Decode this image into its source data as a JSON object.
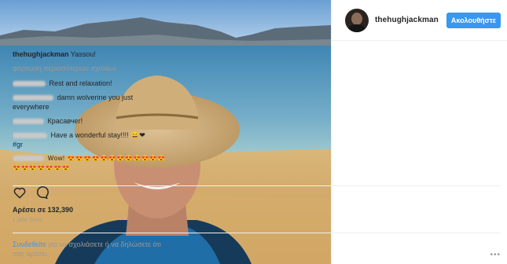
{
  "header": {
    "username": "thehughjackman",
    "follow_label": "Ακολουθήστε"
  },
  "caption": {
    "author": "thehughjackman",
    "text": "Yassou!"
  },
  "load_more": "φόρτωση περισσότερων σχολίων",
  "comments": [
    {
      "text": "Rest and relaxation!"
    },
    {
      "text": "damn wolverine you just everywhere"
    },
    {
      "text": "Красавчег!"
    },
    {
      "text": "Have a wonderful stay!!!! 😄❤",
      "tag": "#gr"
    },
    {
      "text": "Wow! 😍😍😍😍😍😍😍😍😍😍😍😍😍😍😍😍😍😍😍"
    }
  ],
  "likes": "Αρέσει σε 132,390",
  "time": "1 ΩΡΑ ΠΡΙΝ",
  "login": {
    "link": "Συνδεθείτε",
    "rest": " για να σχολιάσετε ή να δηλώσετε ότι σας αρέσει."
  },
  "icons": {
    "heart": "heart-icon",
    "comment": "comment-icon",
    "more": "more-options-icon"
  },
  "colors": {
    "accent": "#3897f0",
    "hashtag": "#003569",
    "muted": "#999999"
  }
}
